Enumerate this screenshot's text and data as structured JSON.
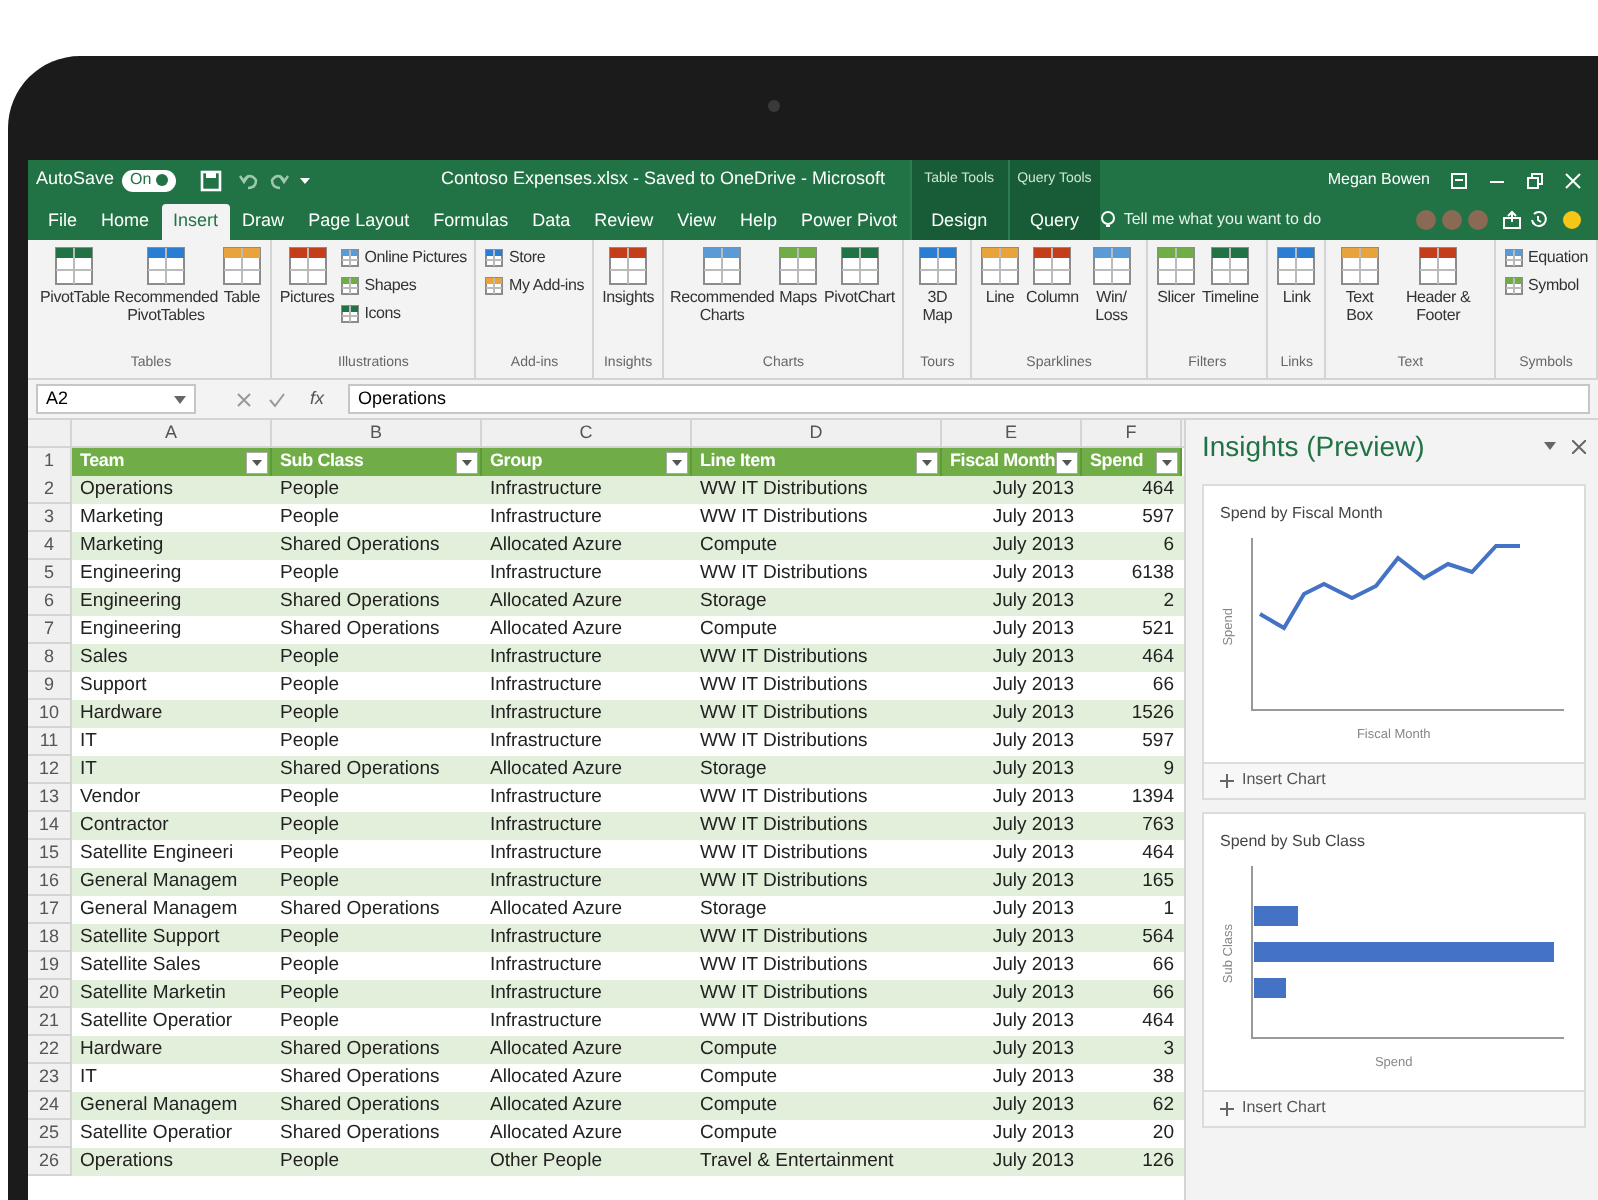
{
  "title_bar": {
    "autosave_label": "AutoSave",
    "autosave": {
      "on": true,
      "label": "On"
    },
    "document_title": "Contoso Expenses.xlsx - Saved to OneDrive - Microsoft",
    "user": "Megan Bowen"
  },
  "tabs": [
    {
      "label": "File",
      "selected": false
    },
    {
      "label": "Home",
      "selected": false
    },
    {
      "label": "Insert",
      "selected": true
    },
    {
      "label": "Draw",
      "selected": false
    },
    {
      "label": "Page Layout",
      "selected": false
    },
    {
      "label": "Formulas",
      "selected": false
    },
    {
      "label": "Data",
      "selected": false
    },
    {
      "label": "Review",
      "selected": false
    },
    {
      "label": "View",
      "selected": false
    },
    {
      "label": "Help",
      "selected": false
    },
    {
      "label": "Power Pivot",
      "selected": false
    }
  ],
  "contextual_tabs": [
    {
      "group": "Table Tools",
      "label": "Design",
      "selected": false
    },
    {
      "group": "Query Tools",
      "label": "Query",
      "selected": false
    }
  ],
  "tell_me": {
    "placeholder": "Tell me what you want to do"
  },
  "ribbon_groups": [
    {
      "label": "Tables",
      "buttons": [
        {
          "kind": "large",
          "label": "PivotTable"
        },
        {
          "kind": "large",
          "label": "Recommended PivotTables"
        },
        {
          "kind": "large",
          "label": "Table"
        }
      ]
    },
    {
      "label": "Illustrations",
      "buttons": [
        {
          "kind": "large",
          "label": "Pictures"
        },
        {
          "kind": "small",
          "label": "Online Pictures"
        },
        {
          "kind": "small",
          "label": "Shapes"
        },
        {
          "kind": "small",
          "label": "Icons"
        }
      ]
    },
    {
      "label": "Add-ins",
      "buttons": [
        {
          "kind": "small",
          "label": "Store"
        },
        {
          "kind": "small",
          "label": "My Add-ins"
        }
      ]
    },
    {
      "label": "Insights",
      "buttons": [
        {
          "kind": "large",
          "label": "Insights"
        }
      ]
    },
    {
      "label": "Charts",
      "buttons": [
        {
          "kind": "large",
          "label": "Recommended Charts"
        },
        {
          "kind": "large",
          "label": "Maps"
        },
        {
          "kind": "large",
          "label": "PivotChart"
        }
      ]
    },
    {
      "label": "Tours",
      "buttons": [
        {
          "kind": "large",
          "label": "3D Map"
        }
      ]
    },
    {
      "label": "Sparklines",
      "buttons": [
        {
          "kind": "large",
          "label": "Line"
        },
        {
          "kind": "large",
          "label": "Column"
        },
        {
          "kind": "large",
          "label": "Win/ Loss"
        }
      ]
    },
    {
      "label": "Filters",
      "buttons": [
        {
          "kind": "large",
          "label": "Slicer"
        },
        {
          "kind": "large",
          "label": "Timeline"
        }
      ]
    },
    {
      "label": "Links",
      "buttons": [
        {
          "kind": "large",
          "label": "Link"
        }
      ]
    },
    {
      "label": "Text",
      "buttons": [
        {
          "kind": "large",
          "label": "Text Box"
        },
        {
          "kind": "large",
          "label": "Header & Footer"
        }
      ]
    },
    {
      "label": "Symbols",
      "buttons": [
        {
          "kind": "small",
          "label": "Equation"
        },
        {
          "kind": "small",
          "label": "Symbol"
        }
      ]
    }
  ],
  "formula_bar": {
    "name_box": "A2",
    "fx": "fx",
    "value": "Operations"
  },
  "sheet": {
    "column_letters": [
      "A",
      "B",
      "C",
      "D",
      "E",
      "F"
    ],
    "header_row": "1",
    "columns": [
      "Team",
      "Sub Class",
      "Group",
      "Line Item",
      "Fiscal Month",
      "Spend"
    ],
    "rows": [
      {
        "number": "2",
        "cells": [
          "Operations",
          "People",
          "Infrastructure",
          "WW IT Distributions",
          "July 2013",
          "464"
        ]
      },
      {
        "number": "3",
        "cells": [
          "Marketing",
          "People",
          "Infrastructure",
          "WW IT Distributions",
          "July 2013",
          "597"
        ]
      },
      {
        "number": "4",
        "cells": [
          "Marketing",
          "Shared Operations",
          "Allocated Azure",
          "Compute",
          "July 2013",
          "6"
        ]
      },
      {
        "number": "5",
        "cells": [
          "Engineering",
          "People",
          "Infrastructure",
          "WW IT Distributions",
          "July 2013",
          "6138"
        ]
      },
      {
        "number": "6",
        "cells": [
          "Engineering",
          "Shared Operations",
          "Allocated Azure",
          "Storage",
          "July 2013",
          "2"
        ]
      },
      {
        "number": "7",
        "cells": [
          "Engineering",
          "Shared Operations",
          "Allocated Azure",
          "Compute",
          "July 2013",
          "521"
        ]
      },
      {
        "number": "8",
        "cells": [
          "Sales",
          "People",
          "Infrastructure",
          "WW IT Distributions",
          "July 2013",
          "464"
        ]
      },
      {
        "number": "9",
        "cells": [
          "Support",
          "People",
          "Infrastructure",
          "WW IT Distributions",
          "July 2013",
          "66"
        ]
      },
      {
        "number": "10",
        "cells": [
          "Hardware",
          "People",
          "Infrastructure",
          "WW IT Distributions",
          "July 2013",
          "1526"
        ]
      },
      {
        "number": "11",
        "cells": [
          "IT",
          "People",
          "Infrastructure",
          "WW IT Distributions",
          "July 2013",
          "597"
        ]
      },
      {
        "number": "12",
        "cells": [
          "IT",
          "Shared Operations",
          "Allocated Azure",
          "Storage",
          "July 2013",
          "9"
        ]
      },
      {
        "number": "13",
        "cells": [
          "Vendor",
          "People",
          "Infrastructure",
          "WW IT Distributions",
          "July 2013",
          "1394"
        ]
      },
      {
        "number": "14",
        "cells": [
          "Contractor",
          "People",
          "Infrastructure",
          "WW IT Distributions",
          "July 2013",
          "763"
        ]
      },
      {
        "number": "15",
        "cells": [
          "Satellite Engineeri",
          "People",
          "Infrastructure",
          "WW IT Distributions",
          "July 2013",
          "464"
        ]
      },
      {
        "number": "16",
        "cells": [
          "General Managem",
          "People",
          "Infrastructure",
          "WW IT Distributions",
          "July 2013",
          "165"
        ]
      },
      {
        "number": "17",
        "cells": [
          "General Managem",
          "Shared Operations",
          "Allocated Azure",
          "Storage",
          "July 2013",
          "1"
        ]
      },
      {
        "number": "18",
        "cells": [
          "Satellite Support",
          "People",
          "Infrastructure",
          "WW IT Distributions",
          "July 2013",
          "564"
        ]
      },
      {
        "number": "19",
        "cells": [
          "Satellite Sales",
          "People",
          "Infrastructure",
          "WW IT Distributions",
          "July 2013",
          "66"
        ]
      },
      {
        "number": "20",
        "cells": [
          "Satellite Marketin",
          "People",
          "Infrastructure",
          "WW IT Distributions",
          "July 2013",
          "66"
        ]
      },
      {
        "number": "21",
        "cells": [
          "Satellite Operatior",
          "People",
          "Infrastructure",
          "WW IT Distributions",
          "July 2013",
          "464"
        ]
      },
      {
        "number": "22",
        "cells": [
          "Hardware",
          "Shared Operations",
          "Allocated Azure",
          "Compute",
          "July 2013",
          "3"
        ]
      },
      {
        "number": "23",
        "cells": [
          "IT",
          "Shared Operations",
          "Allocated Azure",
          "Compute",
          "July 2013",
          "38"
        ]
      },
      {
        "number": "24",
        "cells": [
          "General Managem",
          "Shared Operations",
          "Allocated Azure",
          "Compute",
          "July 2013",
          "62"
        ]
      },
      {
        "number": "25",
        "cells": [
          "Satellite Operatior",
          "Shared Operations",
          "Allocated Azure",
          "Compute",
          "July 2013",
          "20"
        ]
      },
      {
        "number": "26",
        "cells": [
          "Operations",
          "People",
          "Other People",
          "Travel & Entertainment",
          "July 2013",
          "126"
        ]
      }
    ]
  },
  "insights": {
    "title": "Insights (Preview)",
    "cards": [
      {
        "kind": "line",
        "title": "Spend by Fiscal Month",
        "ylabel": "Spend",
        "xlabel": "Fiscal Month",
        "button": "Insert Chart"
      },
      {
        "kind": "bar",
        "title": "Spend by Sub Class",
        "ylabel": "Sub Class",
        "xlabel": "Spend",
        "button": "Insert Chart"
      }
    ]
  }
}
